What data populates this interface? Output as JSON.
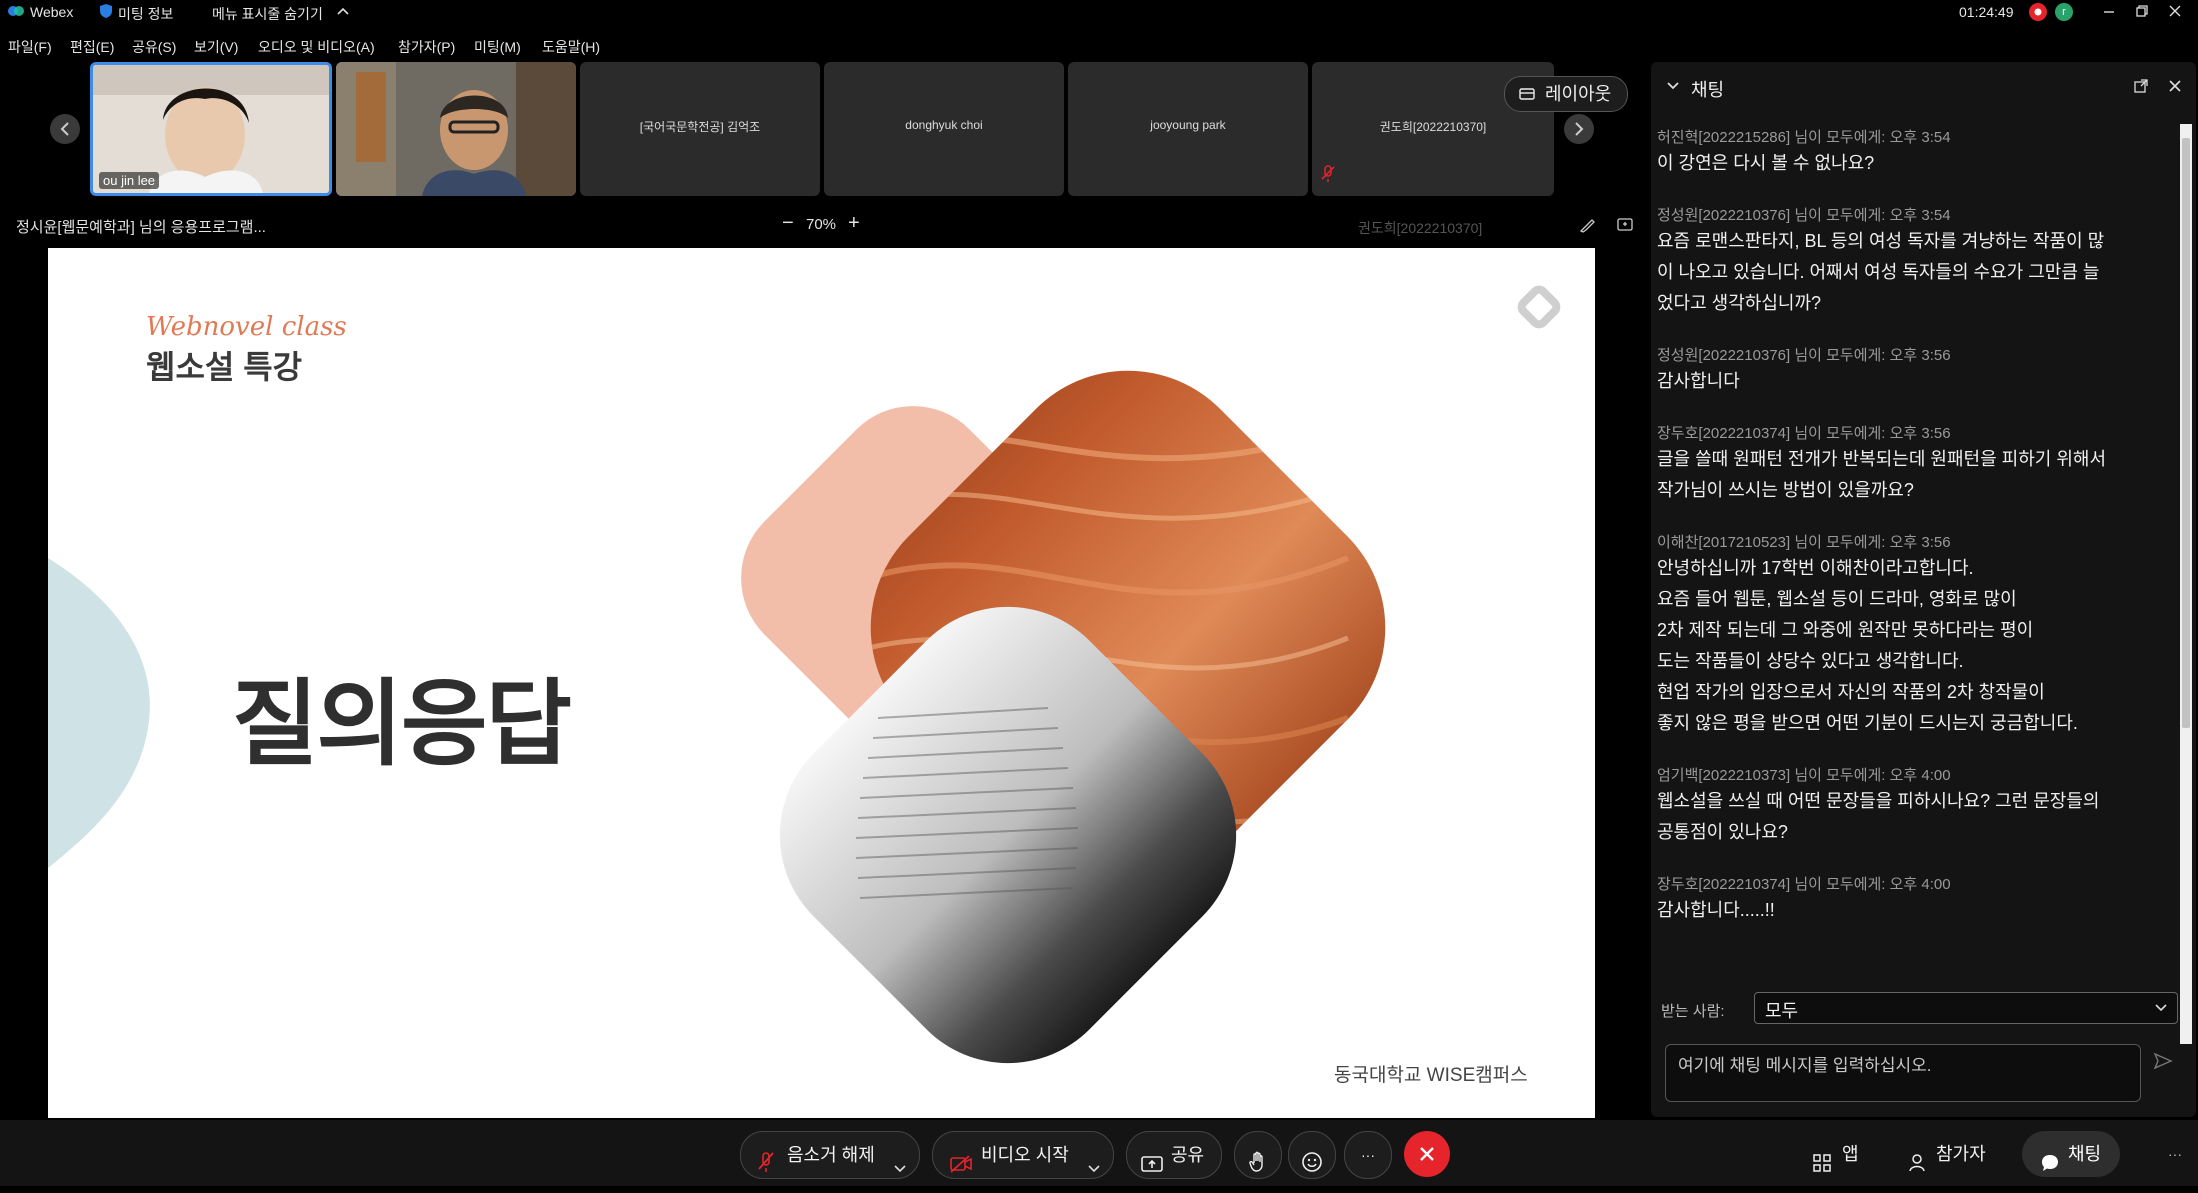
{
  "titlebar": {
    "app_name": "Webex",
    "meeting_info": "미팅 정보",
    "hide_menu": "메뉴 표시줄 숨기기",
    "clock": "01:24:49",
    "avatar_initial": "r"
  },
  "menubar": {
    "items": [
      "파일(F)",
      "편집(E)",
      "공유(S)",
      "보기(V)",
      "오디오 및 비디오(A)",
      "참가자(P)",
      "미팅(M)",
      "도움말(H)"
    ]
  },
  "participants": {
    "self_name": "ou jin lee",
    "names": [
      "[국어국문학전공] 김억조",
      "donghyuk choi",
      "jooyoung park",
      "권도희[2022210370]"
    ],
    "layout_button": "레이아웃"
  },
  "share": {
    "sharer_label": "정시윤[웹문예학과] 님의 응용프로그램...",
    "zoom_level": "70%",
    "zoom_minus": "−",
    "zoom_plus": "+",
    "ghost_name": "권도희[2022210370]"
  },
  "slide": {
    "script_title": "Webnovel class",
    "title": "웹소설 특강",
    "heading": "질의응답",
    "footer": "동국대학교 WISE캠퍼스"
  },
  "chat": {
    "title": "채팅",
    "messages": [
      {
        "header": "허진혁[2022215286] 님이 모두에게:   오후 3:54",
        "lines": [
          "이 강연은 다시 볼 수 없나요?"
        ]
      },
      {
        "header": "정성원[2022210376] 님이 모두에게:   오후 3:54",
        "lines": [
          "요즘 로맨스판타지, BL 등의 여성 독자를 겨냥하는 작품이 많",
          "이 나오고 있습니다. 어째서 여성 독자들의 수요가 그만큼 늘",
          "었다고 생각하십니까?"
        ]
      },
      {
        "header": "정성원[2022210376] 님이 모두에게:   오후 3:56",
        "lines": [
          "감사합니다"
        ]
      },
      {
        "header": "장두호[2022210374] 님이 모두에게:   오후 3:56",
        "lines": [
          "글을 쓸때 원패턴 전개가 반복되는데 원패턴을 피하기 위해서",
          "작가님이 쓰시는 방법이 있을까요?"
        ]
      },
      {
        "header": "이해찬[2017210523] 님이 모두에게:   오후 3:56",
        "lines": [
          "안녕하십니까 17학번 이해찬이라고합니다.",
          "요즘 들어 웹툰, 웹소설 등이 드라마, 영화로 많이",
          "2차 제작 되는데 그 와중에 원작만 못하다라는 평이",
          "도는 작품들이 상당수 있다고 생각합니다.",
          "현업 작가의 입장으로서 자신의 작품의 2차 창작물이",
          "좋지 않은 평을 받으면 어떤 기분이 드시는지 궁금합니다."
        ]
      },
      {
        "header": "엄기백[2022210373] 님이 모두에게:   오후 4:00",
        "lines": [
          "웹소설을 쓰실 때 어떤 문장들을 피하시나요? 그런 문장들의",
          "공통점이 있나요?"
        ]
      },
      {
        "header": "장두호[2022210374] 님이 모두에게:   오후 4:00",
        "lines": [
          "감사합니다.....!!"
        ]
      }
    ],
    "recipient_label": "받는 사람:",
    "recipient_value": "모두",
    "input_placeholder": "여기에 채팅 메시지를 입력하십시오."
  },
  "controls": {
    "unmute": "음소거 해제",
    "start_video": "비디오 시작",
    "share": "공유",
    "more": "···",
    "apps": "앱",
    "participants": "참가자",
    "chat": "채팅"
  },
  "colors": {
    "end_call": "#e5242b",
    "slide_accent": "#e07a55",
    "leaf": "#cfe3e6",
    "tile_bg": "#2b2b2b",
    "chat_bg": "#141414"
  }
}
